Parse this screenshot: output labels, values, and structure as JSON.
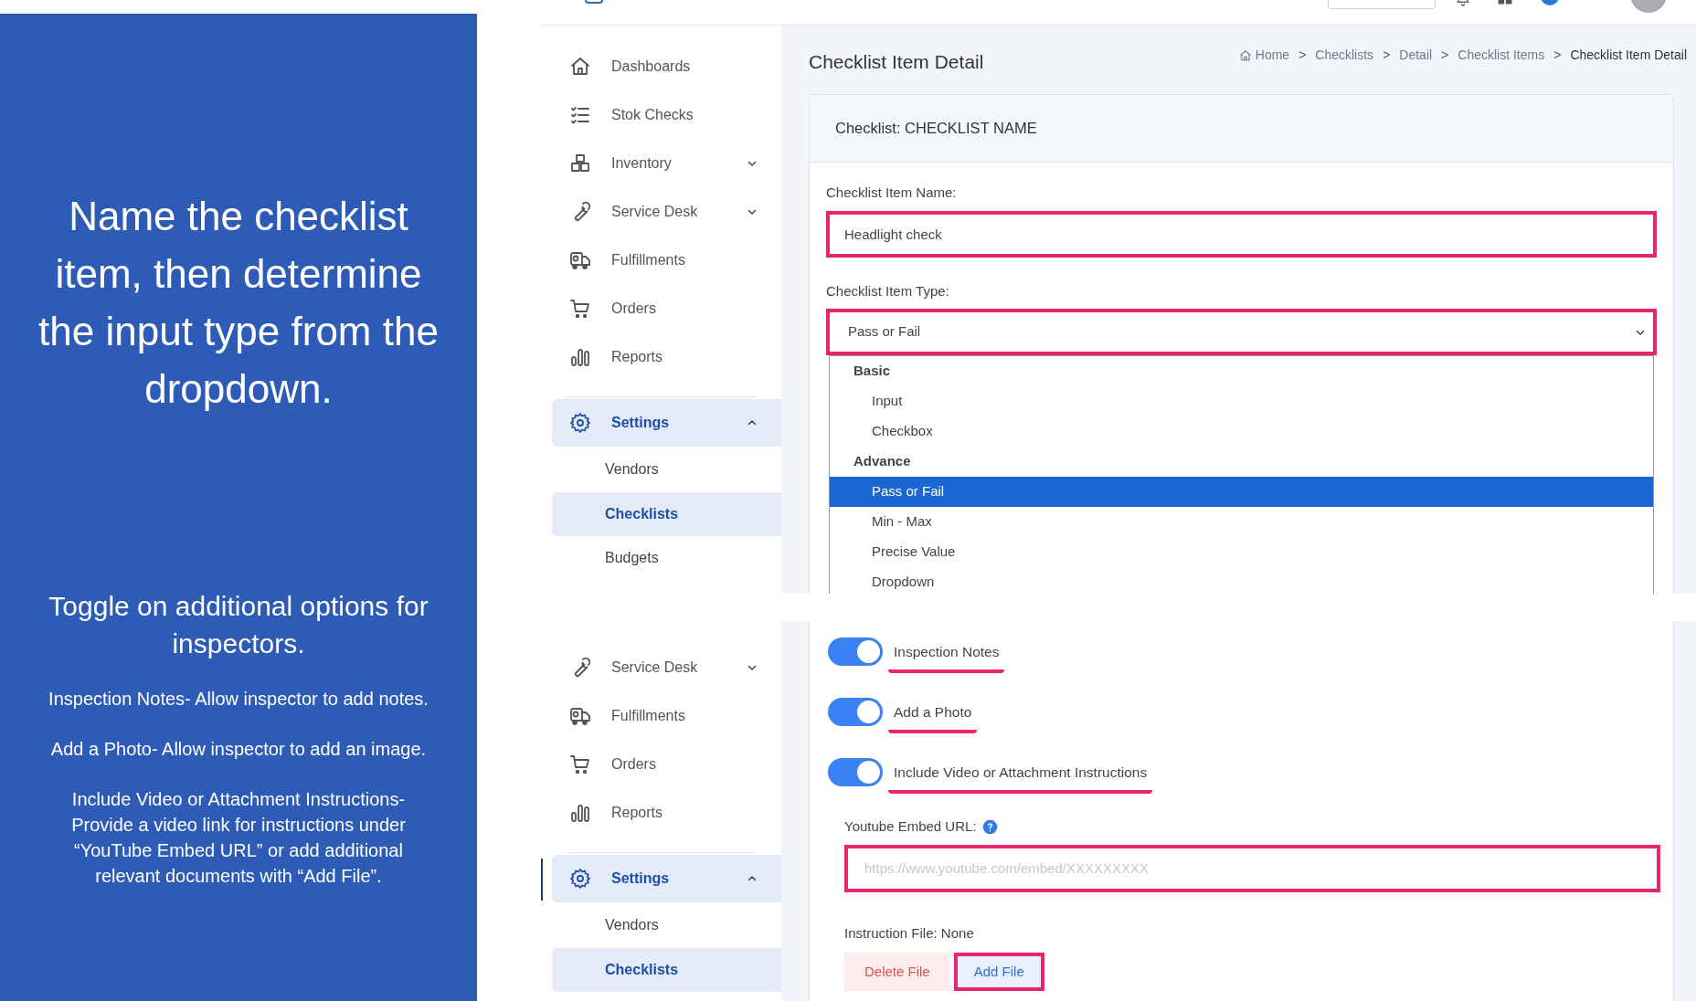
{
  "left_panel": {
    "heading": "Name the checklist item, then determine the input type from the dropdown.",
    "subheading": "Toggle on additional options for inspectors.",
    "notes": [
      "Inspection Notes- Allow inspector to add notes.",
      "Add a Photo- Allow inspector to add an image.",
      "Include Video or Attachment Instructions- Provide a video link for instructions under “YouTube Embed URL” or add additional relevant documents with “Add File”."
    ]
  },
  "top_screenshot": {
    "sidebar": {
      "items": [
        {
          "label": "Dashboards",
          "selected": false
        },
        {
          "label": "Stok Checks",
          "selected": false
        },
        {
          "label": "Inventory",
          "selected": false,
          "expanded": false
        },
        {
          "label": "Service Desk",
          "selected": false,
          "expanded": false
        },
        {
          "label": "Fulfillments",
          "selected": false
        },
        {
          "label": "Orders",
          "selected": false
        },
        {
          "label": "Reports",
          "selected": false
        },
        {
          "label": "Settings",
          "selected": true,
          "expanded": true,
          "children": [
            {
              "label": "Vendors",
              "selected": false
            },
            {
              "label": "Checklists",
              "selected": true
            },
            {
              "label": "Budgets",
              "selected": false
            }
          ]
        }
      ]
    },
    "page_title": "Checklist Item Detail",
    "breadcrumb": [
      "Home",
      "Checklists",
      "Detail",
      "Checklist Items",
      "Checklist Item Detail"
    ],
    "breadcrumb_separator": ">",
    "card": {
      "header": "Checklist: CHECKLIST NAME",
      "name_field": {
        "label": "Checklist Item Name:",
        "value": "Headlight check",
        "highlighted": true
      },
      "type_field": {
        "label": "Checklist Item Type:",
        "value": "Pass or Fail",
        "highlighted": true,
        "expanded": true,
        "option_groups": [
          {
            "label": "Basic",
            "options": [
              {
                "label": "Input",
                "selected": false
              },
              {
                "label": "Checkbox",
                "selected": false
              }
            ]
          },
          {
            "label": "Advance",
            "options": [
              {
                "label": "Pass or Fail",
                "selected": true
              },
              {
                "label": "Min - Max",
                "selected": false
              },
              {
                "label": "Precise Value",
                "selected": false
              },
              {
                "label": "Dropdown",
                "selected": false
              }
            ]
          }
        ]
      }
    }
  },
  "bottom_screenshot": {
    "sidebar": {
      "items": [
        {
          "label": "Service Desk",
          "selected": false,
          "expanded": false
        },
        {
          "label": "Fulfillments",
          "selected": false
        },
        {
          "label": "Orders",
          "selected": false
        },
        {
          "label": "Reports",
          "selected": false
        },
        {
          "label": "Settings",
          "selected": true,
          "expanded": true,
          "children": [
            {
              "label": "Vendors",
              "selected": false
            },
            {
              "label": "Checklists",
              "selected": true
            }
          ]
        }
      ]
    },
    "toggles": [
      {
        "label": "Inspection Notes",
        "on": true,
        "highlighted": true
      },
      {
        "label": "Add a Photo",
        "on": true,
        "highlighted": true
      },
      {
        "label": "Include Video or Attachment Instructions",
        "on": true,
        "highlighted": true
      }
    ],
    "youtube_field": {
      "label": "Youtube Embed URL:",
      "placeholder": "https://www.youtube.com/embed/XXXXXXXXX",
      "highlighted": true
    },
    "instruction_file": "Instruction File: None",
    "buttons": [
      {
        "label": "Delete File",
        "kind": "danger",
        "highlighted": false
      },
      {
        "label": "Add File",
        "kind": "primary",
        "highlighted": true
      }
    ]
  }
}
